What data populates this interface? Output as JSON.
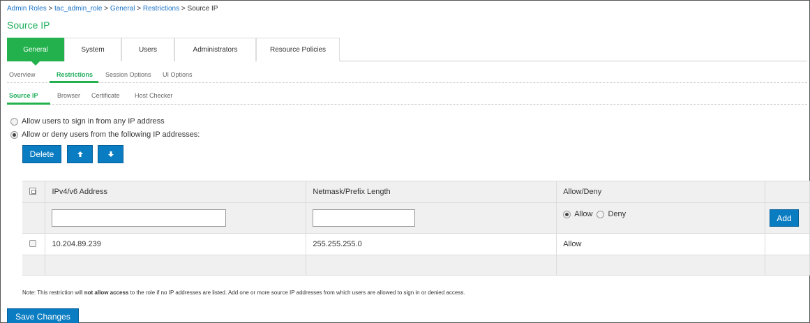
{
  "breadcrumb": {
    "items": [
      "Admin Roles",
      "tac_admin_role",
      "General",
      "Restrictions"
    ],
    "separator": ">",
    "current": "Source IP"
  },
  "page_title": "Source IP",
  "main_tabs": [
    "General",
    "System",
    "Users",
    "Administrators",
    "Resource Policies"
  ],
  "main_tab_active": "General",
  "sub_tabs": [
    "Overview",
    "Restrictions",
    "Session Options",
    "UI Options"
  ],
  "sub_tab_active": "Restrictions",
  "sub_tabs2": [
    "Source IP",
    "Browser",
    "Certificate",
    "Host Checker"
  ],
  "sub_tab2_active": "Source IP",
  "options": {
    "any_ip": "Allow users to sign in from any IP address",
    "specific_ip": "Allow or deny users from the following IP addresses:",
    "selected": "specific_ip"
  },
  "buttons": {
    "delete": "Delete",
    "move_up_icon": "arrow-up-icon",
    "move_down_icon": "arrow-down-icon",
    "add": "Add",
    "save": "Save Changes"
  },
  "table": {
    "headers": [
      "IPv4/v6 Address",
      "Netmask/Prefix Length",
      "Allow/Deny"
    ],
    "new_row": {
      "address_value": "",
      "netmask_value": "",
      "allow_label": "Allow",
      "deny_label": "Deny",
      "selected": "Allow"
    },
    "rows": [
      {
        "address": "10.204.89.239",
        "netmask": "255.255.255.0",
        "action": "Allow"
      }
    ]
  },
  "note": {
    "prefix": "Note: This restriction will ",
    "bold": "not allow access",
    "suffix": " to the role if no IP addresses are listed. Add one or more source IP addresses from which users are allowed to sign in or denied access."
  },
  "colors": {
    "accent_green": "#22b14c",
    "button_blue": "#0a7cc1",
    "link_blue": "#1a73c6"
  }
}
